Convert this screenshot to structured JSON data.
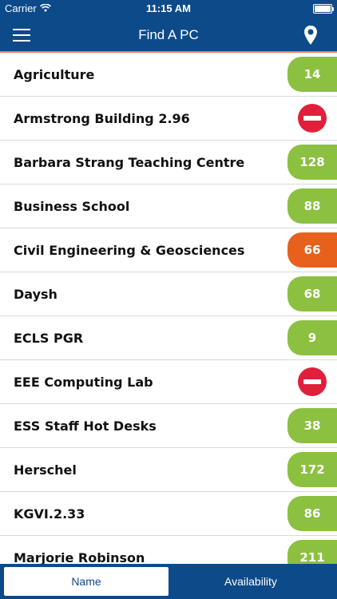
{
  "statusbar": {
    "carrier": "Carrier",
    "time": "11:15 AM"
  },
  "navbar": {
    "title": "Find A PC",
    "menu_icon": "hamburger-menu-icon",
    "location_icon": "map-pin-icon"
  },
  "colors": {
    "primary": "#0d4a8a",
    "accent_line": "#ee7b4c",
    "available": "#8cc040",
    "busy": "#e8611c",
    "closed": "#e0203b"
  },
  "rooms": [
    {
      "name": "Agriculture",
      "count": "14",
      "status": "green"
    },
    {
      "name": "Armstrong Building 2.96",
      "count": null,
      "status": "closed"
    },
    {
      "name": "Barbara Strang Teaching Centre",
      "count": "128",
      "status": "green"
    },
    {
      "name": "Business School",
      "count": "88",
      "status": "green"
    },
    {
      "name": "Civil Engineering & Geosciences",
      "count": "66",
      "status": "orange"
    },
    {
      "name": "Daysh",
      "count": "68",
      "status": "green"
    },
    {
      "name": "ECLS PGR",
      "count": "9",
      "status": "green"
    },
    {
      "name": "EEE Computing Lab",
      "count": null,
      "status": "closed"
    },
    {
      "name": "ESS Staff Hot Desks",
      "count": "38",
      "status": "green"
    },
    {
      "name": "Herschel",
      "count": "172",
      "status": "green"
    },
    {
      "name": "KGVI.2.33",
      "count": "86",
      "status": "green"
    },
    {
      "name": "Marjorie Robinson",
      "count": "211",
      "status": "green"
    }
  ],
  "tabs": {
    "name_label": "Name",
    "availability_label": "Availability"
  }
}
